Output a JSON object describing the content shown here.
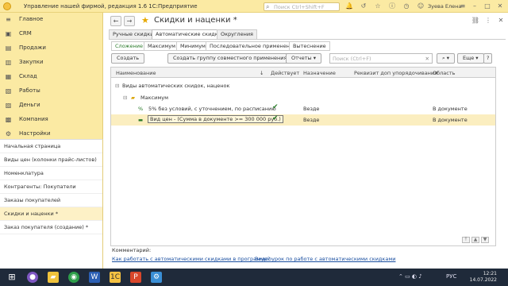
{
  "titlebar": {
    "title": "Управление нашей фирмой, редакция 1.6 1С:Предприятие",
    "search_placeholder": "Поиск Ctrl+Shift+F",
    "user": "Зуева Елена"
  },
  "sidebar": {
    "items": [
      {
        "label": "Главное",
        "icon": "≡"
      },
      {
        "label": "CRM",
        "icon": "▣"
      },
      {
        "label": "Продажи",
        "icon": "▤"
      },
      {
        "label": "Закупки",
        "icon": "▥"
      },
      {
        "label": "Склад",
        "icon": "▦"
      },
      {
        "label": "Работы",
        "icon": "▧"
      },
      {
        "label": "Деньги",
        "icon": "▨"
      },
      {
        "label": "Компания",
        "icon": "▩"
      },
      {
        "label": "Настройки",
        "icon": "⚙"
      }
    ]
  },
  "open_windows": [
    {
      "label": "Начальная страница",
      "active": false
    },
    {
      "label": "Виды цен (колонки прайс-листов)",
      "active": false
    },
    {
      "label": "Номенклатура",
      "active": false
    },
    {
      "label": "Контрагенты: Покупатели",
      "active": false
    },
    {
      "label": "Заказы покупателей",
      "active": false
    },
    {
      "label": "Скидки и наценки *",
      "active": true
    },
    {
      "label": "Заказ покупателя (создание) *",
      "active": false
    }
  ],
  "main": {
    "title": "Скидки и наценки *",
    "tabs": [
      "Ручные скидки",
      "Автоматические скидки",
      "Округления"
    ],
    "subtabs": [
      "Сложение",
      "Максимум",
      "Минимум",
      "Последовательное применение",
      "Вытеснение"
    ],
    "buttons": {
      "create": "Создать",
      "create_group": "Создать группу совместного применения",
      "reports": "Отчеты",
      "more": "Еще"
    },
    "grid_search_placeholder": "Поиск (Ctrl+F)",
    "columns": [
      "Наименование",
      "Действует",
      "Назначение",
      "Реквизит доп упорядочивания",
      "Область"
    ],
    "rows": [
      {
        "name": "Виды автоматических скидок, наценок",
        "active": "",
        "purpose": "",
        "extra": "",
        "area": ""
      },
      {
        "name": "Максимум",
        "active": "",
        "purpose": "",
        "extra": "",
        "area": ""
      },
      {
        "name": "5% без условий, с уточнением, по расписанию",
        "active": "✔",
        "purpose": "Везде",
        "extra": "",
        "area": "В документе"
      },
      {
        "name": "Вид цен - (Сумма в документе >= 300 000 руб.)",
        "active": "✔",
        "purpose": "Везде",
        "extra": "",
        "area": "В документе"
      }
    ],
    "comment_label": "Комментарий:",
    "links": [
      "Как работать с автоматическими скидками в программе?",
      "Видеоурок по работе с автоматическими скидками"
    ]
  },
  "taskbar": {
    "lang": "РУС",
    "time": "12:21",
    "date": "14.07.2022"
  }
}
